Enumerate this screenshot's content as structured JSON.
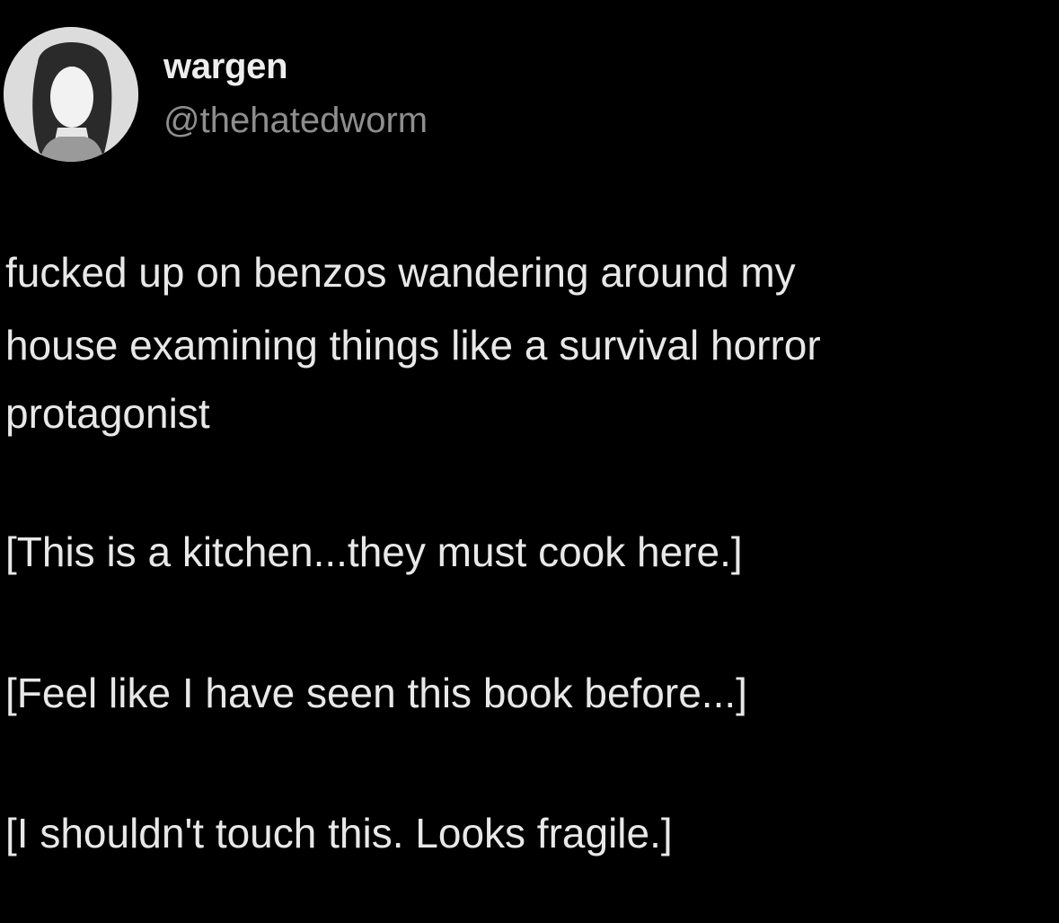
{
  "author": {
    "display_name": "wargen",
    "handle": "@thehatedworm",
    "avatar_icon": "profile-photo-avatar"
  },
  "tweet": {
    "lines": [
      "fucked up on benzos wandering around my",
      "house examining things like a survival horror",
      "protagonist",
      "[This is a kitchen...they must cook here.]",
      "[Feel like I have seen this book before...]",
      "[I shouldn't touch this. Looks fragile.]"
    ]
  },
  "colors": {
    "background": "#000000",
    "text": "#e8e8e8",
    "handle": "#8e8e8e"
  }
}
